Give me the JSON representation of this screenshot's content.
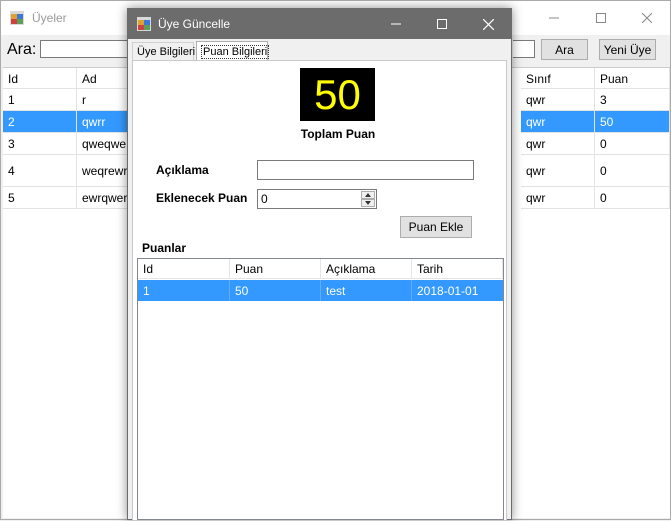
{
  "background_window": {
    "title": "Üyeler",
    "search_label": "Ara:",
    "search_value": "",
    "search_button": "Ara",
    "new_member_button": "Yeni Üye",
    "grid": {
      "columns_left": [
        "Id",
        "Ad"
      ],
      "columns_right": [
        "Sınıf",
        "Puan"
      ],
      "rows": [
        {
          "id": "1",
          "ad": "r",
          "sinif": "qwr",
          "puan": "3",
          "selected": false
        },
        {
          "id": "2",
          "ad": "qwrr",
          "sinif": "qwr",
          "puan": "50",
          "selected": true
        },
        {
          "id": "3",
          "ad": "qweqwe",
          "sinif": "qwr",
          "puan": "0",
          "selected": false
        },
        {
          "id": "4",
          "ad": "weqrewr",
          "sinif": "qwr",
          "puan": "0",
          "selected": false
        },
        {
          "id": "5",
          "ad": "ewrqwer",
          "sinif": "qwr",
          "puan": "0",
          "selected": false
        }
      ]
    }
  },
  "dialog": {
    "title": "Üye Güncelle",
    "tabs": [
      {
        "label": "Üye Bilgileri",
        "active": false
      },
      {
        "label": "Puan Bilgileri",
        "active": true
      }
    ],
    "score_value": "50",
    "score_caption": "Toplam Puan",
    "aciklama_label": "Açıklama",
    "aciklama_value": "",
    "ekle_label": "Eklenecek Puan",
    "ekle_value": "0",
    "add_button": "Puan Ekle",
    "puanlar_label": "Puanlar",
    "list": {
      "columns": [
        "Id",
        "Puan",
        "Açıklama",
        "Tarih"
      ],
      "rows": [
        {
          "id": "1",
          "puan": "50",
          "aciklama": "test",
          "tarih": "2018-01-01",
          "selected": true
        }
      ]
    }
  },
  "icons": {
    "app": "app-window-icon",
    "minimize": "minimize-icon",
    "maximize": "maximize-icon",
    "close": "close-icon",
    "spin_up": "spin-up-icon",
    "spin_down": "spin-down-icon"
  },
  "colors": {
    "selection": "#3399ff",
    "score_bg": "#000000",
    "score_fg": "#ffff00",
    "dialog_titlebar": "#6d6c6c"
  }
}
